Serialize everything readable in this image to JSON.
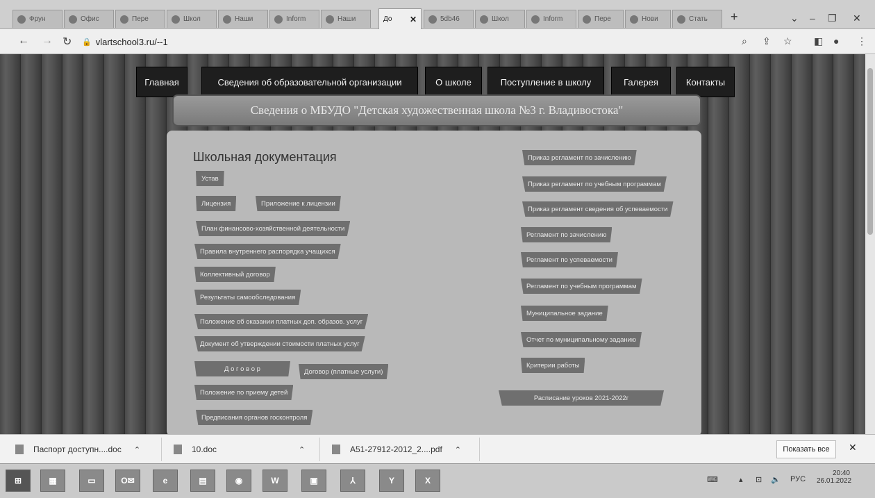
{
  "browser": {
    "tabs": [
      {
        "label": "Фрун"
      },
      {
        "label": "Офис"
      },
      {
        "label": "Пере"
      },
      {
        "label": "Школ"
      },
      {
        "label": "Наши"
      },
      {
        "label": "Inform"
      },
      {
        "label": "Наши"
      },
      {
        "label": "До",
        "active": true
      },
      {
        "label": "5db46"
      },
      {
        "label": "Школ"
      },
      {
        "label": "Inform"
      },
      {
        "label": "Пере"
      },
      {
        "label": "Нови"
      },
      {
        "label": "Стать"
      }
    ],
    "new_tab": "+",
    "url": "vlartschool3.ru/--1"
  },
  "site": {
    "menu": {
      "home": "Главная",
      "info": "Сведения об образовательной организации",
      "about": "О школе",
      "admission": "Поступление в школу",
      "gallery": "Галерея",
      "contacts": "Контакты"
    },
    "banner": "Сведения о МБУДО \"Детская художественная школа №3 г. Владивостока\"",
    "heading": "Школьная документация",
    "left_docs": {
      "ustav": "Устав",
      "license": "Лицензия",
      "license_app": "Приложение к лицензии",
      "fin_plan": "План финансово-хозяйственной деятельности",
      "rules": "Правила внутреннего распорядка учащихся",
      "collective": "Коллективный договор",
      "selfcheck": "Результаты самообследования",
      "paid_services": "Положение об оказании платных доп. образов. услуг",
      "cost_doc": "Документ об утверждении стоимости платных услуг",
      "contract": "Д о г о в о р",
      "contract_paid": "Договор (платные услуги)",
      "admission_reg": "Положение по приему детей",
      "prescriptions": "Предписания органов госконтроля"
    },
    "right_docs": [
      "Приказ регламент по зачислению",
      "Приказ регламент по учебным программам",
      "Приказ регламент сведения об успеваемости",
      "Регламент по зачислению",
      "Регламент по успеваемости",
      "Регламент по учебным программам",
      "Муниципальное задание",
      "Отчет по муниципальному заданию",
      "Критерии работы",
      "Расписание уроков 2021-2022г"
    ]
  },
  "downloads": {
    "items": [
      {
        "name": "Паспорт доступн....doc"
      },
      {
        "name": "10.doc"
      },
      {
        "name": "A51-27912-2012_2....pdf"
      }
    ],
    "show_all": "Показать все"
  },
  "taskbar": {
    "lang": "РУС",
    "time": "20:40",
    "date": "26.01.2022"
  }
}
